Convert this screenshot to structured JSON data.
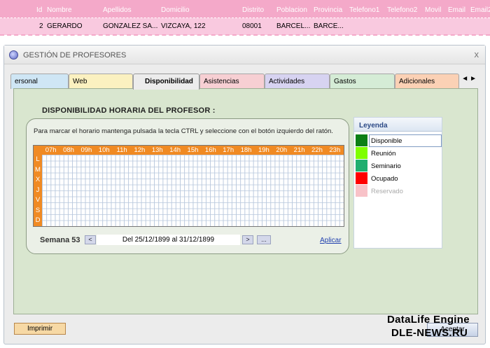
{
  "top_grid": {
    "headers": [
      "Id",
      "Nombre",
      "Apellidos",
      "Domicilio",
      "Distrito",
      "Poblacion",
      "Provincia",
      "Telefono1",
      "Telefono2",
      "Movil",
      "Email",
      "Email2"
    ],
    "row": [
      "2",
      "GERARDO",
      "GONZALEZ SA...",
      "VIZCAYA, 122",
      "08001",
      "BARCEL...",
      "BARCE..."
    ]
  },
  "window": {
    "title": "GESTIÓN DE PROFESORES",
    "close": "x"
  },
  "tabs": [
    {
      "label": "ersonal",
      "color": "#cfe6f5"
    },
    {
      "label": "Web",
      "color": "#fbf1c0"
    },
    {
      "label": "Disponibilidad",
      "color": "#ececec",
      "active": true
    },
    {
      "label": "Asistencias",
      "color": "#f7cfd3"
    },
    {
      "label": "Actividades",
      "color": "#d7d3f1"
    },
    {
      "label": "Gastos",
      "color": "#d5ecd6"
    },
    {
      "label": "Adicionales",
      "color": "#fbd1b5"
    }
  ],
  "tab_arrows": "◄►",
  "section_title": "DISPONIBILIDAD HORARIA DEL PROFESOR :",
  "hint": "Para marcar el horario mantenga pulsada la tecla CTRL y seleccione con el botón izquierdo del ratón.",
  "schedule": {
    "hours": [
      "07h",
      "08h",
      "09h",
      "10h",
      "11h",
      "12h",
      "13h",
      "14h",
      "15h",
      "16h",
      "17h",
      "18h",
      "19h",
      "20h",
      "21h",
      "22h",
      "23h"
    ],
    "days": [
      "L",
      "M",
      "X",
      "J",
      "V",
      "S",
      "D"
    ]
  },
  "week": {
    "label": "Semana 53",
    "prev": "<",
    "range": "Del  25/12/1899  al  31/12/1899",
    "next": ">",
    "more": "...",
    "apply": "Aplicar"
  },
  "legend": {
    "title": "Leyenda",
    "items": [
      {
        "label": "Disponible",
        "color": "#0c7f16"
      },
      {
        "label": "Reunión",
        "color": "#7fff00"
      },
      {
        "label": "Seminario",
        "color": "#1fae6f"
      },
      {
        "label": "Ocupado",
        "color": "#ff0000"
      },
      {
        "label": "Reservado",
        "color": "#f8c2c8"
      }
    ]
  },
  "buttons": {
    "print": "Imprimir",
    "accept": "Aceptar"
  },
  "watermark": {
    "line1": "DataLife Engine",
    "line2": "DLE-NEWS.RU"
  }
}
